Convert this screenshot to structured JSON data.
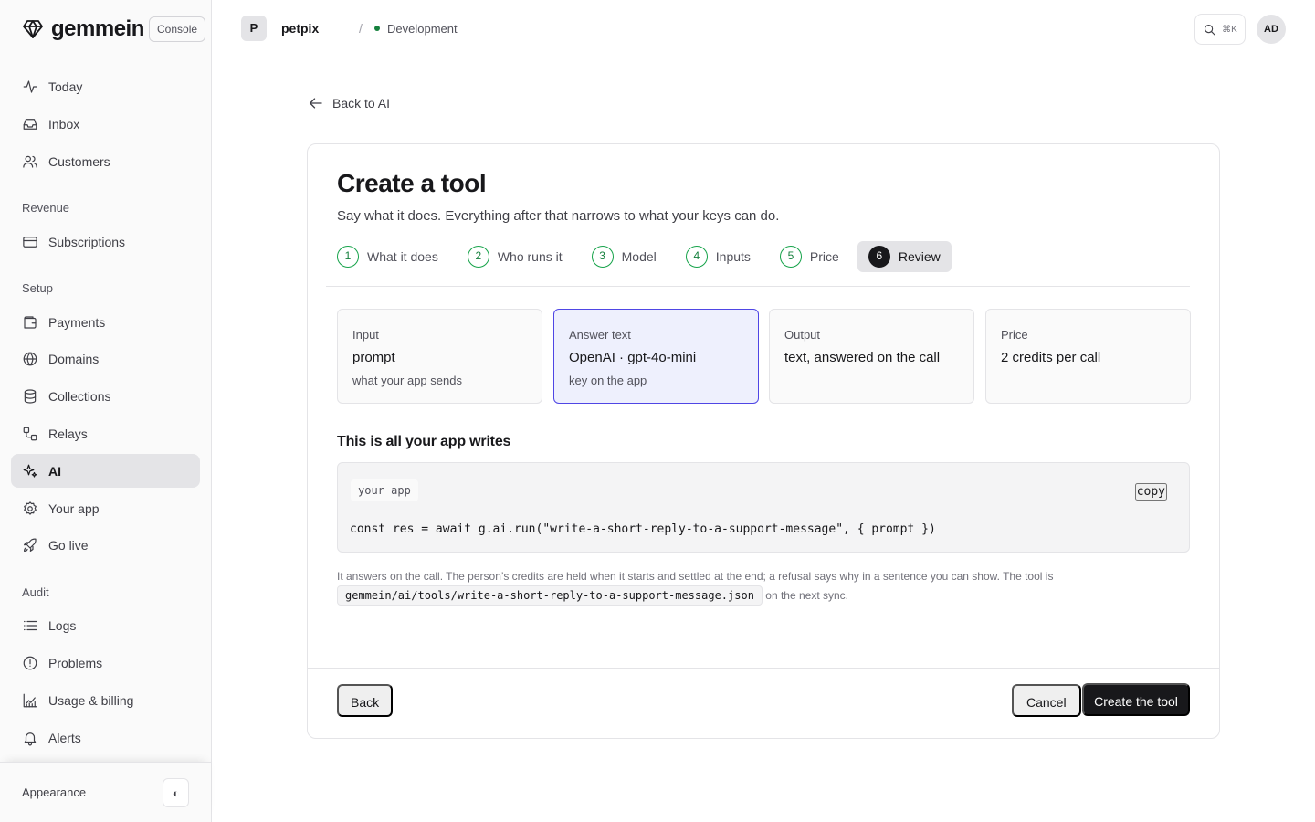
{
  "brand": {
    "name": "gemmein",
    "console_badge": "Console"
  },
  "sidebar": {
    "items_top": [
      {
        "label": "Today",
        "icon": "activity-icon"
      },
      {
        "label": "Inbox",
        "icon": "inbox-icon"
      },
      {
        "label": "Customers",
        "icon": "users-icon"
      }
    ],
    "sections": [
      {
        "title": "Revenue",
        "items": [
          {
            "label": "Subscriptions",
            "icon": "credit-card-icon"
          }
        ]
      },
      {
        "title": "Setup",
        "items": [
          {
            "label": "Payments",
            "icon": "wallet-icon"
          },
          {
            "label": "Domains",
            "icon": "globe-icon"
          },
          {
            "label": "Collections",
            "icon": "database-icon"
          },
          {
            "label": "Relays",
            "icon": "relay-icon"
          },
          {
            "label": "AI",
            "icon": "sparkles-icon",
            "active": true
          },
          {
            "label": "Your app",
            "icon": "gear-icon"
          },
          {
            "label": "Go live",
            "icon": "rocket-icon"
          }
        ]
      },
      {
        "title": "Audit",
        "items": [
          {
            "label": "Logs",
            "icon": "list-icon"
          },
          {
            "label": "Problems",
            "icon": "alert-circle-icon"
          },
          {
            "label": "Usage & billing",
            "icon": "chart-icon"
          },
          {
            "label": "Alerts",
            "icon": "bell-icon"
          }
        ]
      }
    ],
    "footer": {
      "appearance_label": "Appearance",
      "toggle_glyph": "◐"
    }
  },
  "topbar": {
    "project_initial": "P",
    "project_name": "petpix",
    "separator": "/",
    "environment": "Development",
    "environment_color": "#15803d",
    "search_shortcut": "⌘K",
    "user_initials": "AD"
  },
  "back_link": "Back to AI",
  "wizard": {
    "title": "Create a tool",
    "subtitle": "Say what it does. Everything after that narrows to what your keys can do.",
    "steps": [
      {
        "num": "1",
        "label": "What it does"
      },
      {
        "num": "2",
        "label": "Who runs it"
      },
      {
        "num": "3",
        "label": "Model"
      },
      {
        "num": "4",
        "label": "Inputs"
      },
      {
        "num": "5",
        "label": "Price"
      },
      {
        "num": "6",
        "label": "Review",
        "current": true
      }
    ],
    "summary": [
      {
        "label": "Input",
        "value": "prompt",
        "note": "what your app sends"
      },
      {
        "label": "Answer text",
        "value": "OpenAI · gpt-4o-mini",
        "note": "key on the app",
        "selected": true
      },
      {
        "label": "Output",
        "value": "text, answered on the call",
        "note": ""
      },
      {
        "label": "Price",
        "value": "2 credits per call",
        "note": ""
      }
    ],
    "code_section": {
      "heading": "This is all your app writes",
      "tag": "your app",
      "copy_label": "copy",
      "code": "const res = await g.ai.run(\"write-a-short-reply-to-a-support-message\", { prompt })"
    },
    "footnote": {
      "before": "It answers on the call. The person’s credits are held when it starts and settled at the end; a refusal says why in a sentence you can show. The tool is ",
      "path": "gemmein/ai/tools/write-a-short-reply-to-a-support-message.json",
      "after": " on the next sync."
    },
    "buttons": {
      "back": "Back",
      "cancel": "Cancel",
      "create": "Create the tool"
    }
  },
  "colors": {
    "accent": "#4f46e5",
    "step_done": "#16a34a",
    "primary": "#18181b"
  }
}
